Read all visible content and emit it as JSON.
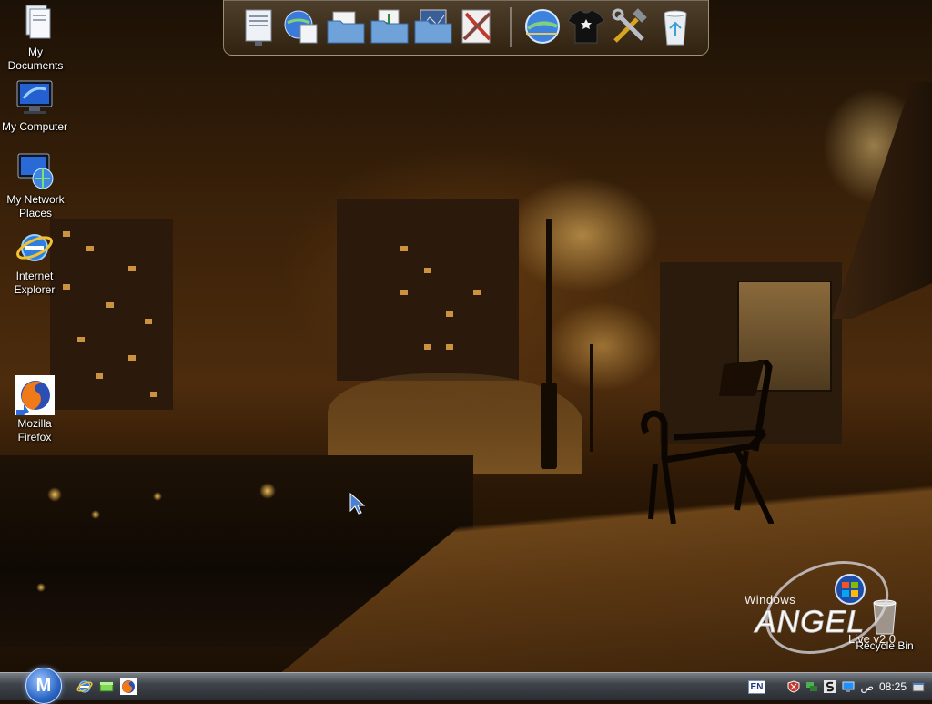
{
  "desktop": {
    "icons": [
      {
        "label": "My Documents"
      },
      {
        "label": "My Computer"
      },
      {
        "label": "My Network Places"
      },
      {
        "label": "Internet Explorer"
      },
      {
        "label": "Mozilla Firefox"
      },
      {
        "label": "Recycle Bin"
      }
    ]
  },
  "dock": {
    "items": [
      {
        "icon": "document-icon"
      },
      {
        "icon": "globe-document-icon"
      },
      {
        "icon": "folder-icon"
      },
      {
        "icon": "music-folder-icon"
      },
      {
        "icon": "pictures-folder-icon"
      },
      {
        "icon": "tools-icon"
      },
      {
        "icon": "globe-network-icon"
      },
      {
        "icon": "tshirt-icon"
      },
      {
        "icon": "hammer-wrench-icon"
      },
      {
        "icon": "recycle-bin-icon"
      }
    ]
  },
  "branding": {
    "line1": "Windows",
    "line2": "ANGEL",
    "line3": "Live v2.0"
  },
  "taskbar": {
    "start_label": "M",
    "quick_launch": [
      "ie-icon",
      "show-desktop-icon",
      "firefox-icon"
    ],
    "tray": {
      "language": "EN",
      "clock": "08:25",
      "ampm": "ص"
    }
  },
  "colors": {
    "sky": "#2a1705",
    "glow": "#e7a84a",
    "taskbar": "#3f444b",
    "start_orb": "#2b66c6"
  }
}
